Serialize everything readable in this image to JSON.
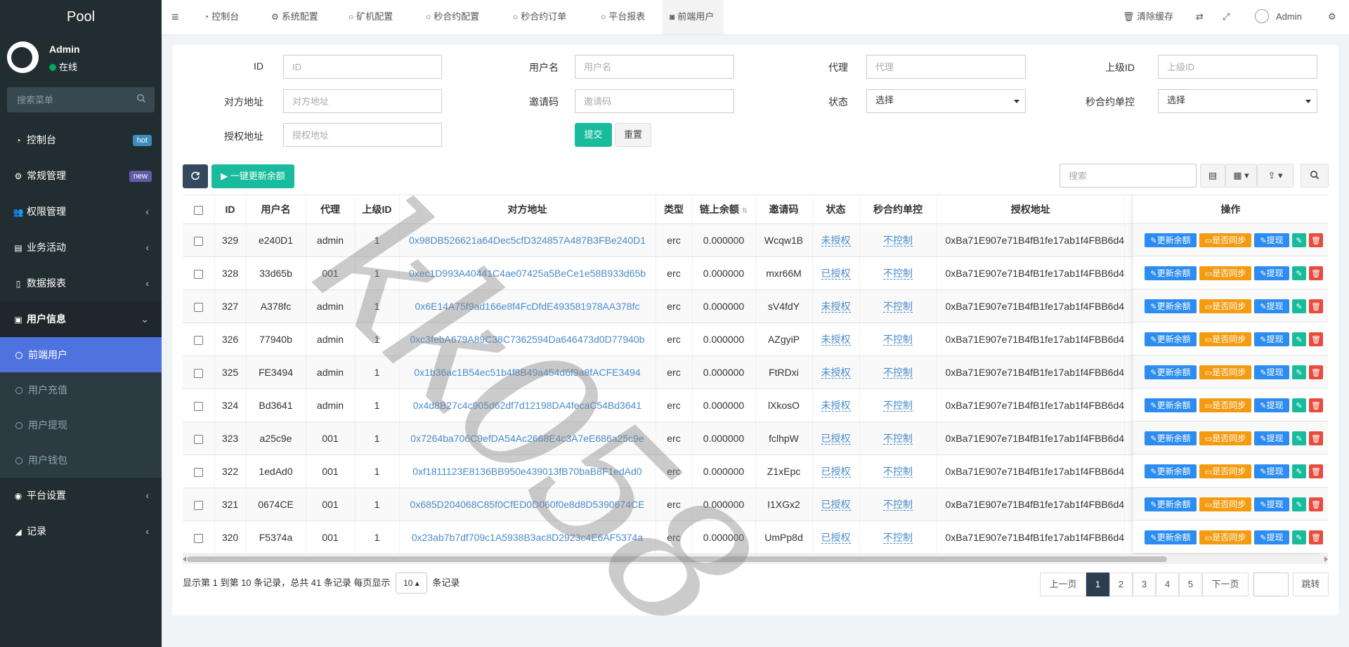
{
  "sidebar": {
    "logo": "Pool",
    "user": {
      "name": "Admin",
      "status": "在线"
    },
    "search_placeholder": "搜索菜单",
    "menu": [
      {
        "label": "控制台",
        "icon": "dashboard-icon",
        "badge": "hot",
        "badge_color": "#3c8dbc"
      },
      {
        "label": "常规管理",
        "icon": "cogs-icon",
        "badge": "new",
        "badge_color": "#605ca8"
      },
      {
        "label": "权限管理",
        "icon": "group-icon"
      },
      {
        "label": "业务活动",
        "icon": "id-card-icon"
      },
      {
        "label": "数据报表",
        "icon": "file-icon"
      },
      {
        "label": "用户信息",
        "icon": "user-icon"
      }
    ],
    "submenu": [
      {
        "label": "前端用户",
        "active": true
      },
      {
        "label": "用户充值"
      },
      {
        "label": "用户提现"
      },
      {
        "label": "用户钱包"
      }
    ],
    "lower_menu": [
      {
        "label": "平台设置",
        "icon": "dot-circle-icon"
      },
      {
        "label": "记录",
        "icon": "area-chart-icon"
      }
    ]
  },
  "topbar": {
    "tabs": [
      {
        "label": "控制台",
        "icon": "dashboard-icon"
      },
      {
        "label": "系统配置",
        "icon": "gear-icon"
      },
      {
        "label": "矿机配置",
        "icon": "circle-icon"
      },
      {
        "label": "秒合约配置",
        "icon": "circle-icon"
      },
      {
        "label": "秒合约订单",
        "icon": "circle-icon"
      },
      {
        "label": "平台报表",
        "icon": "circle-icon"
      },
      {
        "label": "前端用户",
        "icon": "user-circle-icon"
      }
    ],
    "clear_cache": "清除缓存",
    "admin": "Admin"
  },
  "filters": {
    "id": {
      "label": "ID",
      "placeholder": "ID"
    },
    "username": {
      "label": "用户名",
      "placeholder": "用户名"
    },
    "agent": {
      "label": "代理",
      "placeholder": "代理"
    },
    "parent_id": {
      "label": "上级ID",
      "placeholder": "上级ID"
    },
    "peer_address": {
      "label": "对方地址",
      "placeholder": "对方地址"
    },
    "invite_code": {
      "label": "邀请码",
      "placeholder": "邀请码"
    },
    "status": {
      "label": "状态",
      "value": "选择"
    },
    "contract_control": {
      "label": "秒合约单控",
      "value": "选择"
    },
    "auth_address": {
      "label": "授权地址",
      "placeholder": "授权地址"
    },
    "submit": "提交",
    "reset": "重置"
  },
  "toolbar": {
    "update_all": "一键更新余额",
    "search_placeholder": "搜索"
  },
  "table": {
    "headers": [
      "ID",
      "用户名",
      "代理",
      "上级ID",
      "对方地址",
      "类型",
      "链上余额",
      "邀请码",
      "状态",
      "秒合约单控",
      "授权地址",
      "操作"
    ],
    "rows": [
      {
        "id": "329",
        "username": "e240D1",
        "agent": "admin",
        "parent": "1",
        "address": "0x98DB526621a64Dec5cfD324857A487B3FBe240D1",
        "type": "erc",
        "balance": "0.000000",
        "invite": "Wcqw1B",
        "status": "未授权",
        "control": "不控制",
        "auth": "0xBa71E907e71B4fB1fe17ab1f4FBB6d4"
      },
      {
        "id": "328",
        "username": "33d65b",
        "agent": "001",
        "parent": "1",
        "address": "0xec1D993A40441C4ae07425a5BeCe1e58B933d65b",
        "type": "erc",
        "balance": "0.000000",
        "invite": "mxr66M",
        "status": "已授权",
        "control": "不控制",
        "auth": "0xBa71E907e71B4fB1fe17ab1f4FBB6d4"
      },
      {
        "id": "327",
        "username": "A378fc",
        "agent": "admin",
        "parent": "1",
        "address": "0x6E14A75f9ad166e8f4FcDfdE493581978AA378fc",
        "type": "erc",
        "balance": "0.000000",
        "invite": "sV4fdY",
        "status": "未授权",
        "control": "不控制",
        "auth": "0xBa71E907e71B4fB1fe17ab1f4FBB6d4"
      },
      {
        "id": "326",
        "username": "77940b",
        "agent": "admin",
        "parent": "1",
        "address": "0xc3febA679A89C38C7362594Da646473d0D77940b",
        "type": "erc",
        "balance": "0.000000",
        "invite": "AZgyiP",
        "status": "未授权",
        "control": "不控制",
        "auth": "0xBa71E907e71B4fB1fe17ab1f4FBB6d4"
      },
      {
        "id": "325",
        "username": "FE3494",
        "agent": "admin",
        "parent": "1",
        "address": "0x1b36ac1B54ec51b4f8B49a454d6f9a8fACFE3494",
        "type": "erc",
        "balance": "0.000000",
        "invite": "FtRDxi",
        "status": "未授权",
        "control": "不控制",
        "auth": "0xBa71E907e71B4fB1fe17ab1f4FBB6d4"
      },
      {
        "id": "324",
        "username": "Bd3641",
        "agent": "admin",
        "parent": "1",
        "address": "0x4d8B27c4c905d62df7d12198DA4fecaC54Bd3641",
        "type": "erc",
        "balance": "0.000000",
        "invite": "lXkosO",
        "status": "未授权",
        "control": "不控制",
        "auth": "0xBa71E907e71B4fB1fe17ab1f4FBB6d4"
      },
      {
        "id": "323",
        "username": "a25c9e",
        "agent": "001",
        "parent": "1",
        "address": "0x7264ba706C9efDA54Ac2668E4c3A7eE686a25c9e",
        "type": "erc",
        "balance": "0.000000",
        "invite": "fclhpW",
        "status": "已授权",
        "control": "不控制",
        "auth": "0xBa71E907e71B4fB1fe17ab1f4FBB6d4"
      },
      {
        "id": "322",
        "username": "1edAd0",
        "agent": "001",
        "parent": "1",
        "address": "0xf1811123E8136BB950e439013fB70baB8F1edAd0",
        "type": "erc",
        "balance": "0.000000",
        "invite": "Z1xEpc",
        "status": "已授权",
        "control": "不控制",
        "auth": "0xBa71E907e71B4fB1fe17ab1f4FBB6d4"
      },
      {
        "id": "321",
        "username": "0674CE",
        "agent": "001",
        "parent": "1",
        "address": "0x685D204068C85f0CfED0D060f0e8d8D5390674CE",
        "type": "erc",
        "balance": "0.000000",
        "invite": "I1XGx2",
        "status": "已授权",
        "control": "不控制",
        "auth": "0xBa71E907e71B4fB1fe17ab1f4FBB6d4"
      },
      {
        "id": "320",
        "username": "F5374a",
        "agent": "001",
        "parent": "1",
        "address": "0x23ab7b7df709c1A5938B3ac8D2923c4E6AF5374a",
        "type": "erc",
        "balance": "0.000000",
        "invite": "UmPp8d",
        "status": "已授权",
        "control": "不控制",
        "auth": "0xBa71E907e71B4fB1fe17ab1f4FBB6d4"
      }
    ],
    "ops": {
      "update": "更新余额",
      "sync": "是否同步",
      "withdraw": "提现"
    }
  },
  "footer": {
    "info_prefix": "显示第 1 到第 10 条记录，总共 41 条记录 每页显示",
    "page_size": "10",
    "info_suffix": "条记录",
    "prev": "上一页",
    "pages": [
      "1",
      "2",
      "3",
      "4",
      "5"
    ],
    "next": "下一页",
    "jump": "跳转"
  },
  "watermark": "kk058"
}
